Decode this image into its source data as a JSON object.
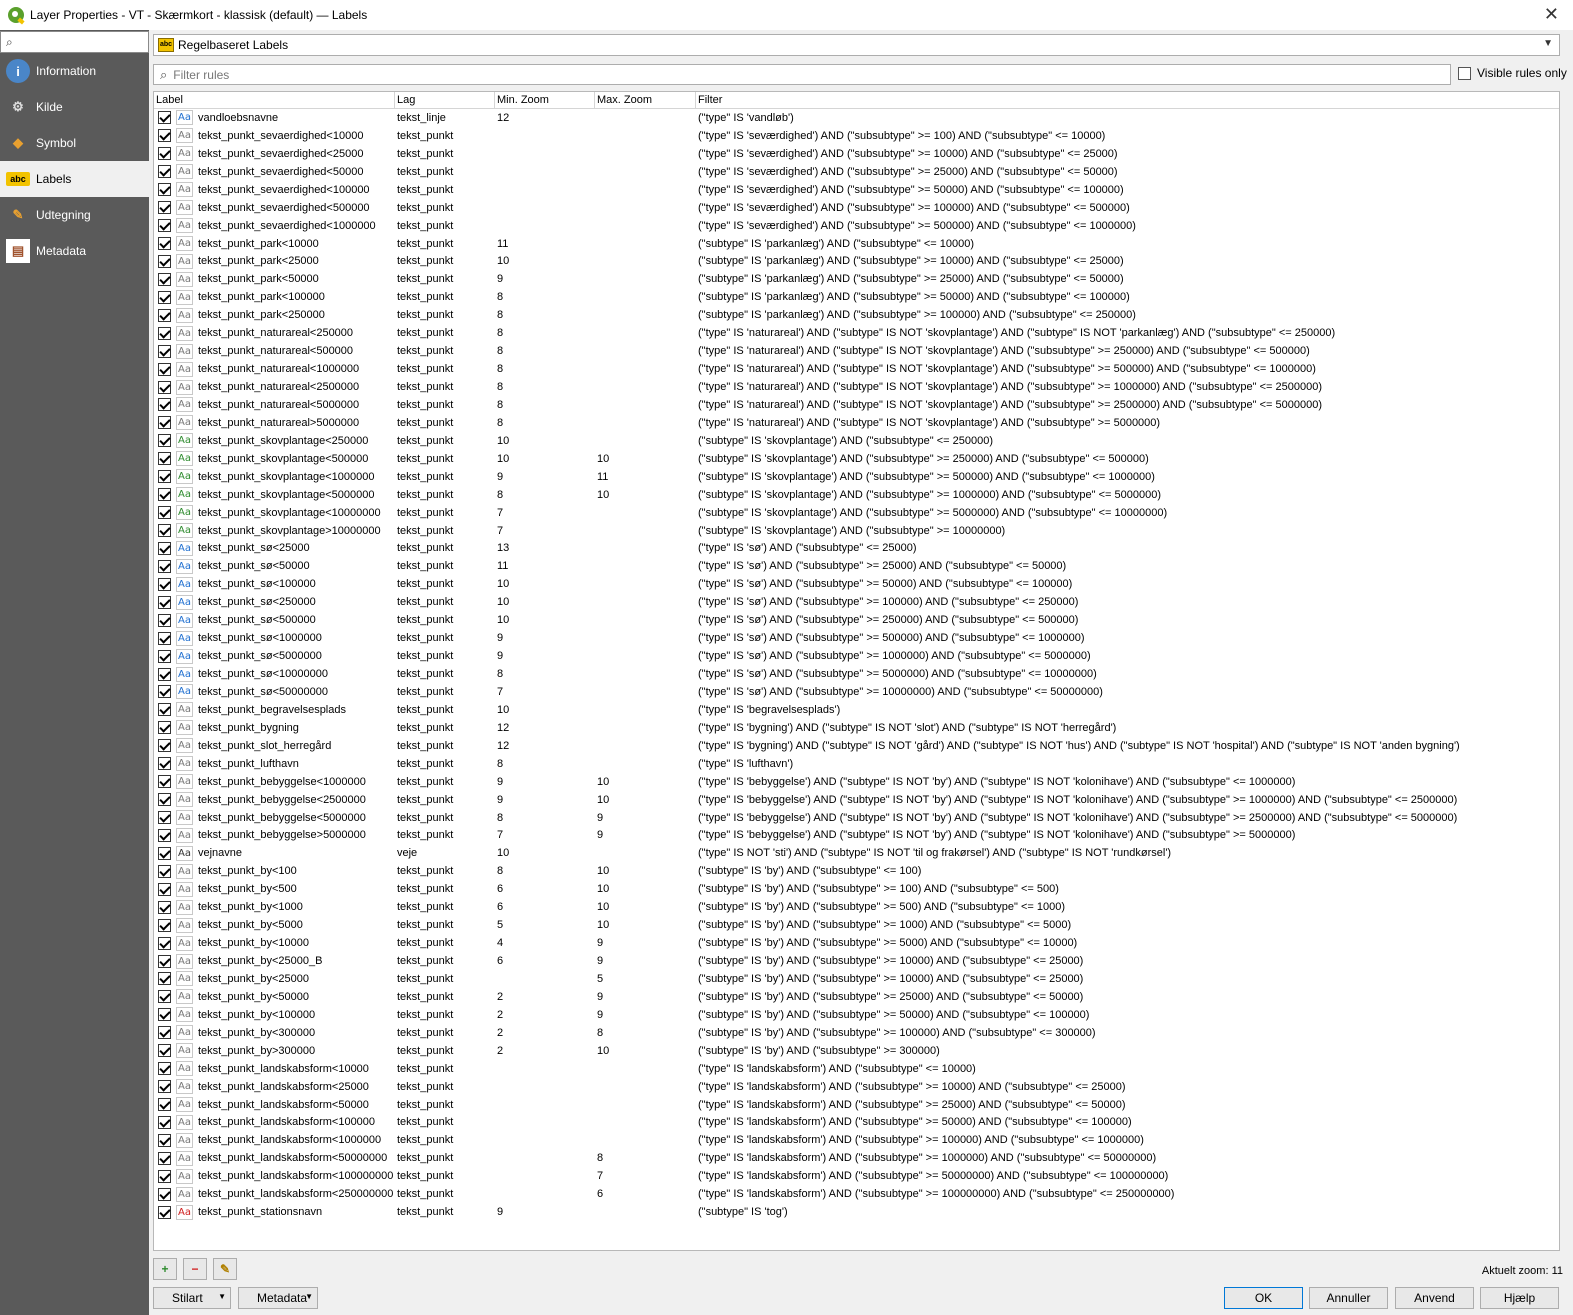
{
  "window": {
    "title": "Layer Properties - VT - Skærmkort - klassisk (default) — Labels",
    "close_glyph": "✕"
  },
  "sidebar": {
    "search_value": "",
    "items": [
      {
        "label": "Information",
        "icon": "info-icon",
        "active": false
      },
      {
        "label": "Kilde",
        "icon": "source-icon",
        "active": false
      },
      {
        "label": "Symbol",
        "icon": "symbol-icon",
        "active": false
      },
      {
        "label": "Labels",
        "icon": "labels-icon",
        "active": true
      },
      {
        "label": "Udtegning",
        "icon": "render-icon",
        "active": false
      },
      {
        "label": "Metadata",
        "icon": "metadata-icon",
        "active": false
      }
    ]
  },
  "renderer": {
    "label": "Regelbaseret Labels",
    "icon_text": "abc"
  },
  "filter": {
    "placeholder": "Filter rules",
    "value": ""
  },
  "visible_only": {
    "label": "Visible rules only",
    "checked": false
  },
  "columns": {
    "label": "Label",
    "lag": "Lag",
    "min": "Min. Zoom",
    "max": "Max. Zoom",
    "filter": "Filter"
  },
  "rows": [
    {
      "label": "vandloebsnavne",
      "lag": "tekst_linje",
      "min": "12",
      "max": "",
      "filter": "(\"type\" IS 'vandløb')",
      "color": "#1f6fd0"
    },
    {
      "label": "tekst_punkt_sevaerdighed<10000",
      "lag": "tekst_punkt",
      "min": "",
      "max": "",
      "filter": "(\"type\" IS 'seværdighed') AND (\"subsubtype\" >= 100) AND (\"subsubtype\" <= 10000)",
      "color": "#777777"
    },
    {
      "label": "tekst_punkt_sevaerdighed<25000",
      "lag": "tekst_punkt",
      "min": "",
      "max": "",
      "filter": "(\"type\" IS 'seværdighed') AND (\"subsubtype\" >= 10000) AND (\"subsubtype\" <= 25000)",
      "color": "#777777"
    },
    {
      "label": "tekst_punkt_sevaerdighed<50000",
      "lag": "tekst_punkt",
      "min": "",
      "max": "",
      "filter": "(\"type\" IS 'seværdighed') AND (\"subsubtype\" >= 25000) AND (\"subsubtype\" <= 50000)",
      "color": "#777777"
    },
    {
      "label": "tekst_punkt_sevaerdighed<100000",
      "lag": "tekst_punkt",
      "min": "",
      "max": "",
      "filter": "(\"type\" IS 'seværdighed') AND (\"subsubtype\" >= 50000) AND (\"subsubtype\" <= 100000)",
      "color": "#777777"
    },
    {
      "label": "tekst_punkt_sevaerdighed<500000",
      "lag": "tekst_punkt",
      "min": "",
      "max": "",
      "filter": "(\"type\" IS 'seværdighed') AND (\"subsubtype\" >= 100000) AND (\"subsubtype\" <= 500000)",
      "color": "#777777"
    },
    {
      "label": "tekst_punkt_sevaerdighed<1000000",
      "lag": "tekst_punkt",
      "min": "",
      "max": "",
      "filter": "(\"type\" IS 'seværdighed') AND (\"subsubtype\" >= 500000) AND (\"subsubtype\" <= 1000000)",
      "color": "#777777"
    },
    {
      "label": "tekst_punkt_park<10000",
      "lag": "tekst_punkt",
      "min": "11",
      "max": "",
      "filter": "(\"subtype\" IS 'parkanlæg') AND (\"subsubtype\" <= 10000)",
      "color": "#777777"
    },
    {
      "label": "tekst_punkt_park<25000",
      "lag": "tekst_punkt",
      "min": "10",
      "max": "",
      "filter": "(\"subtype\" IS 'parkanlæg') AND (\"subsubtype\" >= 10000) AND (\"subsubtype\" <= 25000)",
      "color": "#777777"
    },
    {
      "label": "tekst_punkt_park<50000",
      "lag": "tekst_punkt",
      "min": "9",
      "max": "",
      "filter": "(\"subtype\" IS 'parkanlæg') AND (\"subsubtype\" >= 25000) AND (\"subsubtype\" <= 50000)",
      "color": "#777777"
    },
    {
      "label": "tekst_punkt_park<100000",
      "lag": "tekst_punkt",
      "min": "8",
      "max": "",
      "filter": "(\"subtype\" IS 'parkanlæg') AND (\"subsubtype\" >= 50000) AND (\"subsubtype\" <= 100000)",
      "color": "#777777"
    },
    {
      "label": "tekst_punkt_park<250000",
      "lag": "tekst_punkt",
      "min": "8",
      "max": "",
      "filter": "(\"subtype\" IS 'parkanlæg') AND (\"subsubtype\" >= 100000) AND (\"subsubtype\" <= 250000)",
      "color": "#777777"
    },
    {
      "label": "tekst_punkt_naturareal<250000",
      "lag": "tekst_punkt",
      "min": "8",
      "max": "",
      "filter": "(\"type\" IS 'naturareal') AND (\"subtype\" IS NOT 'skovplantage') AND (\"subtype\" IS NOT 'parkanlæg') AND (\"subsubtype\" <= 250000)",
      "color": "#777777"
    },
    {
      "label": "tekst_punkt_naturareal<500000",
      "lag": "tekst_punkt",
      "min": "8",
      "max": "",
      "filter": "(\"type\" IS 'naturareal') AND (\"subtype\" IS NOT 'skovplantage') AND (\"subsubtype\" >= 250000) AND (\"subsubtype\" <= 500000)",
      "color": "#777777"
    },
    {
      "label": "tekst_punkt_naturareal<1000000",
      "lag": "tekst_punkt",
      "min": "8",
      "max": "",
      "filter": "(\"type\" IS 'naturareal') AND (\"subtype\" IS NOT 'skovplantage') AND (\"subsubtype\" >= 500000) AND (\"subsubtype\" <= 1000000)",
      "color": "#777777"
    },
    {
      "label": "tekst_punkt_naturareal<2500000",
      "lag": "tekst_punkt",
      "min": "8",
      "max": "",
      "filter": "(\"type\" IS 'naturareal') AND (\"subtype\" IS NOT 'skovplantage') AND (\"subsubtype\" >= 1000000) AND (\"subsubtype\" <= 2500000)",
      "color": "#777777"
    },
    {
      "label": "tekst_punkt_naturareal<5000000",
      "lag": "tekst_punkt",
      "min": "8",
      "max": "",
      "filter": "(\"type\" IS 'naturareal') AND (\"subtype\" IS NOT 'skovplantage') AND (\"subsubtype\" >= 2500000) AND (\"subsubtype\" <= 5000000)",
      "color": "#777777"
    },
    {
      "label": "tekst_punkt_naturareal>5000000",
      "lag": "tekst_punkt",
      "min": "8",
      "max": "",
      "filter": "(\"type\" IS 'naturareal') AND (\"subtype\" IS NOT 'skovplantage') AND (\"subsubtype\" >= 5000000)",
      "color": "#777777"
    },
    {
      "label": "tekst_punkt_skovplantage<250000",
      "lag": "tekst_punkt",
      "min": "10",
      "max": "",
      "filter": "(\"subtype\" IS 'skovplantage') AND (\"subsubtype\" <= 250000)",
      "color": "#2e8b2e"
    },
    {
      "label": "tekst_punkt_skovplantage<500000",
      "lag": "tekst_punkt",
      "min": "10",
      "max": "10",
      "filter": "(\"subtype\" IS 'skovplantage') AND (\"subsubtype\" >= 250000) AND (\"subsubtype\" <= 500000)",
      "color": "#2e8b2e"
    },
    {
      "label": "tekst_punkt_skovplantage<1000000",
      "lag": "tekst_punkt",
      "min": "9",
      "max": "11",
      "filter": "(\"subtype\" IS 'skovplantage') AND (\"subsubtype\" >= 500000) AND (\"subsubtype\" <= 1000000)",
      "color": "#2e8b2e"
    },
    {
      "label": "tekst_punkt_skovplantage<5000000",
      "lag": "tekst_punkt",
      "min": "8",
      "max": "10",
      "filter": "(\"subtype\" IS 'skovplantage') AND (\"subsubtype\" >= 1000000) AND (\"subsubtype\" <= 5000000)",
      "color": "#2e8b2e"
    },
    {
      "label": "tekst_punkt_skovplantage<10000000",
      "lag": "tekst_punkt",
      "min": "7",
      "max": "",
      "filter": "(\"subtype\" IS 'skovplantage') AND (\"subsubtype\" >= 5000000) AND (\"subsubtype\" <= 10000000)",
      "color": "#2e8b2e"
    },
    {
      "label": "tekst_punkt_skovplantage>10000000",
      "lag": "tekst_punkt",
      "min": "7",
      "max": "",
      "filter": "(\"subtype\" IS 'skovplantage') AND (\"subsubtype\" >= 10000000)",
      "color": "#2e8b2e"
    },
    {
      "label": "tekst_punkt_sø<25000",
      "lag": "tekst_punkt",
      "min": "13",
      "max": "",
      "filter": "(\"type\" IS 'sø') AND (\"subsubtype\" <= 25000)",
      "color": "#1f6fd0"
    },
    {
      "label": "tekst_punkt_sø<50000",
      "lag": "tekst_punkt",
      "min": "11",
      "max": "",
      "filter": "(\"type\" IS 'sø') AND (\"subsubtype\" >= 25000) AND (\"subsubtype\" <= 50000)",
      "color": "#1f6fd0"
    },
    {
      "label": "tekst_punkt_sø<100000",
      "lag": "tekst_punkt",
      "min": "10",
      "max": "",
      "filter": "(\"type\" IS 'sø') AND (\"subsubtype\" >= 50000) AND (\"subsubtype\" <= 100000)",
      "color": "#1f6fd0"
    },
    {
      "label": "tekst_punkt_sø<250000",
      "lag": "tekst_punkt",
      "min": "10",
      "max": "",
      "filter": "(\"type\" IS 'sø') AND (\"subsubtype\" >= 100000) AND (\"subsubtype\" <= 250000)",
      "color": "#1f6fd0"
    },
    {
      "label": "tekst_punkt_sø<500000",
      "lag": "tekst_punkt",
      "min": "10",
      "max": "",
      "filter": "(\"type\" IS 'sø') AND (\"subsubtype\" >= 250000) AND (\"subsubtype\" <= 500000)",
      "color": "#1f6fd0"
    },
    {
      "label": "tekst_punkt_sø<1000000",
      "lag": "tekst_punkt",
      "min": "9",
      "max": "",
      "filter": "(\"type\" IS 'sø') AND (\"subsubtype\" >= 500000) AND (\"subsubtype\" <= 1000000)",
      "color": "#1f6fd0"
    },
    {
      "label": "tekst_punkt_sø<5000000",
      "lag": "tekst_punkt",
      "min": "9",
      "max": "",
      "filter": "(\"type\" IS 'sø') AND (\"subsubtype\" >= 1000000) AND (\"subsubtype\" <= 5000000)",
      "color": "#1f6fd0"
    },
    {
      "label": "tekst_punkt_sø<10000000",
      "lag": "tekst_punkt",
      "min": "8",
      "max": "",
      "filter": "(\"type\" IS 'sø') AND (\"subsubtype\" >= 5000000) AND (\"subsubtype\" <= 10000000)",
      "color": "#1f6fd0"
    },
    {
      "label": "tekst_punkt_sø<50000000",
      "lag": "tekst_punkt",
      "min": "7",
      "max": "",
      "filter": "(\"type\" IS 'sø') AND (\"subsubtype\" >= 10000000) AND (\"subsubtype\" <= 50000000)",
      "color": "#1f6fd0"
    },
    {
      "label": "tekst_punkt_begravelsesplads",
      "lag": "tekst_punkt",
      "min": "10",
      "max": "",
      "filter": "(\"type\" IS 'begravelsesplads')",
      "color": "#777777"
    },
    {
      "label": "tekst_punkt_bygning",
      "lag": "tekst_punkt",
      "min": "12",
      "max": "",
      "filter": "(\"type\" IS 'bygning') AND (\"subtype\" IS NOT 'slot') AND (\"subtype\" IS NOT 'herregård')",
      "color": "#777777"
    },
    {
      "label": "tekst_punkt_slot_herregård",
      "lag": "tekst_punkt",
      "min": "12",
      "max": "",
      "filter": "(\"type\" IS 'bygning') AND (\"subtype\" IS NOT 'gård') AND (\"subtype\" IS NOT 'hus') AND (\"subtype\" IS NOT 'hospital') AND (\"subtype\" IS NOT 'anden bygning')",
      "color": "#777777"
    },
    {
      "label": "tekst_punkt_lufthavn",
      "lag": "tekst_punkt",
      "min": "8",
      "max": "",
      "filter": "(\"type\" IS 'lufthavn')",
      "color": "#777777"
    },
    {
      "label": "tekst_punkt_bebyggelse<1000000",
      "lag": "tekst_punkt",
      "min": "9",
      "max": "10",
      "filter": "(\"type\" IS 'bebyggelse') AND (\"subtype\" IS NOT 'by') AND (\"subtype\" IS NOT 'kolonihave') AND (\"subsubtype\" <= 1000000)",
      "color": "#777777"
    },
    {
      "label": "tekst_punkt_bebyggelse<2500000",
      "lag": "tekst_punkt",
      "min": "9",
      "max": "10",
      "filter": "(\"type\" IS 'bebyggelse') AND (\"subtype\" IS NOT 'by') AND (\"subtype\" IS NOT 'kolonihave') AND (\"subsubtype\" >= 1000000) AND (\"subsubtype\" <= 2500000)",
      "color": "#777777"
    },
    {
      "label": "tekst_punkt_bebyggelse<5000000",
      "lag": "tekst_punkt",
      "min": "8",
      "max": "9",
      "filter": "(\"type\" IS 'bebyggelse') AND (\"subtype\" IS NOT 'by') AND (\"subtype\" IS NOT 'kolonihave') AND (\"subsubtype\" >= 2500000) AND (\"subsubtype\" <= 5000000)",
      "color": "#777777"
    },
    {
      "label": "tekst_punkt_bebyggelse>5000000",
      "lag": "tekst_punkt",
      "min": "7",
      "max": "9",
      "filter": "(\"type\" IS 'bebyggelse') AND (\"subtype\" IS NOT 'by') AND (\"subtype\" IS NOT 'kolonihave') AND (\"subsubtype\" >= 5000000)",
      "color": "#777777"
    },
    {
      "label": "vejnavne",
      "lag": "veje",
      "min": "10",
      "max": "",
      "filter": "(\"type\" IS NOT 'sti') AND (\"subtype\" IS NOT 'til og frakørsel') AND (\"subtype\" IS NOT 'rundkørsel')",
      "color": "#333333"
    },
    {
      "label": "tekst_punkt_by<100",
      "lag": "tekst_punkt",
      "min": "8",
      "max": "10",
      "filter": "(\"subtype\" IS 'by') AND (\"subsubtype\" <= 100)",
      "color": "#777777"
    },
    {
      "label": "tekst_punkt_by<500",
      "lag": "tekst_punkt",
      "min": "6",
      "max": "10",
      "filter": "(\"subtype\" IS 'by') AND (\"subsubtype\" >= 100) AND (\"subsubtype\" <= 500)",
      "color": "#777777"
    },
    {
      "label": "tekst_punkt_by<1000",
      "lag": "tekst_punkt",
      "min": "6",
      "max": "10",
      "filter": "(\"subtype\" IS 'by') AND (\"subsubtype\" >= 500) AND (\"subsubtype\" <= 1000)",
      "color": "#777777"
    },
    {
      "label": "tekst_punkt_by<5000",
      "lag": "tekst_punkt",
      "min": "5",
      "max": "10",
      "filter": "(\"subtype\" IS 'by') AND (\"subsubtype\" >= 1000) AND (\"subsubtype\" <= 5000)",
      "color": "#777777"
    },
    {
      "label": "tekst_punkt_by<10000",
      "lag": "tekst_punkt",
      "min": "4",
      "max": "9",
      "filter": "(\"subtype\" IS 'by') AND (\"subsubtype\" >= 5000) AND (\"subsubtype\" <= 10000)",
      "color": "#777777"
    },
    {
      "label": "tekst_punkt_by<25000_B",
      "lag": "tekst_punkt",
      "min": "6",
      "max": "9",
      "filter": "(\"subtype\" IS 'by') AND (\"subsubtype\" >= 10000) AND (\"subsubtype\" <= 25000)",
      "color": "#777777"
    },
    {
      "label": "tekst_punkt_by<25000",
      "lag": "tekst_punkt",
      "min": "",
      "max": "5",
      "filter": "(\"subtype\" IS 'by') AND (\"subsubtype\" >= 10000) AND (\"subsubtype\" <= 25000)",
      "color": "#777777"
    },
    {
      "label": "tekst_punkt_by<50000",
      "lag": "tekst_punkt",
      "min": "2",
      "max": "9",
      "filter": "(\"subtype\" IS 'by') AND (\"subsubtype\" >= 25000) AND (\"subsubtype\" <= 50000)",
      "color": "#777777"
    },
    {
      "label": "tekst_punkt_by<100000",
      "lag": "tekst_punkt",
      "min": "2",
      "max": "9",
      "filter": "(\"subtype\" IS 'by') AND (\"subsubtype\" >= 50000) AND (\"subsubtype\" <= 100000)",
      "color": "#777777"
    },
    {
      "label": "tekst_punkt_by<300000",
      "lag": "tekst_punkt",
      "min": "2",
      "max": "8",
      "filter": "(\"subtype\" IS 'by') AND (\"subsubtype\" >= 100000) AND (\"subsubtype\" <= 300000)",
      "color": "#777777"
    },
    {
      "label": "tekst_punkt_by>300000",
      "lag": "tekst_punkt",
      "min": "2",
      "max": "10",
      "filter": "(\"subtype\" IS 'by') AND (\"subsubtype\" >= 300000)",
      "color": "#777777"
    },
    {
      "label": "tekst_punkt_landskabsform<10000",
      "lag": "tekst_punkt",
      "min": "",
      "max": "",
      "filter": "(\"type\" IS 'landskabsform') AND (\"subsubtype\" <= 10000)",
      "color": "#777777"
    },
    {
      "label": "tekst_punkt_landskabsform<25000",
      "lag": "tekst_punkt",
      "min": "",
      "max": "",
      "filter": "(\"type\" IS 'landskabsform') AND (\"subsubtype\" >= 10000) AND (\"subsubtype\" <= 25000)",
      "color": "#777777"
    },
    {
      "label": "tekst_punkt_landskabsform<50000",
      "lag": "tekst_punkt",
      "min": "",
      "max": "",
      "filter": "(\"type\" IS 'landskabsform') AND (\"subsubtype\" >= 25000) AND (\"subsubtype\" <= 50000)",
      "color": "#777777"
    },
    {
      "label": "tekst_punkt_landskabsform<100000",
      "lag": "tekst_punkt",
      "min": "",
      "max": "",
      "filter": "(\"type\" IS 'landskabsform') AND (\"subsubtype\" >= 50000) AND (\"subsubtype\" <= 100000)",
      "color": "#777777"
    },
    {
      "label": "tekst_punkt_landskabsform<1000000",
      "lag": "tekst_punkt",
      "min": "",
      "max": "",
      "filter": "(\"type\" IS 'landskabsform') AND (\"subsubtype\" >= 100000) AND (\"subsubtype\" <= 1000000)",
      "color": "#777777"
    },
    {
      "label": "tekst_punkt_landskabsform<50000000",
      "lag": "tekst_punkt",
      "min": "",
      "max": "8",
      "filter": "(\"type\" IS 'landskabsform') AND (\"subsubtype\" >= 1000000) AND (\"subsubtype\" <= 50000000)",
      "color": "#777777"
    },
    {
      "label": "tekst_punkt_landskabsform<100000000",
      "lag": "tekst_punkt",
      "min": "",
      "max": "7",
      "filter": "(\"type\" IS 'landskabsform') AND (\"subsubtype\" >= 50000000) AND (\"subsubtype\" <= 100000000)",
      "color": "#777777"
    },
    {
      "label": "tekst_punkt_landskabsform<250000000",
      "lag": "tekst_punkt",
      "min": "",
      "max": "6",
      "filter": "(\"type\" IS 'landskabsform') AND (\"subsubtype\" >= 100000000) AND (\"subsubtype\" <= 250000000)",
      "color": "#777777"
    },
    {
      "label": "tekst_punkt_stationsnavn",
      "lag": "tekst_punkt",
      "min": "9",
      "max": "",
      "filter": "(\"subtype\" IS 'tog')",
      "color": "#d02020"
    }
  ],
  "symbol_text": "Aa",
  "check_glyph": "✓",
  "tools": {
    "add": "+",
    "remove": "−",
    "edit": "✎"
  },
  "zoom": {
    "label": "Aktuelt zoom: 11"
  },
  "buttons": {
    "stilart": "Stilart",
    "metadata": "Metadata",
    "ok": "OK",
    "cancel": "Annuller",
    "apply": "Anvend",
    "help": "Hjælp"
  }
}
